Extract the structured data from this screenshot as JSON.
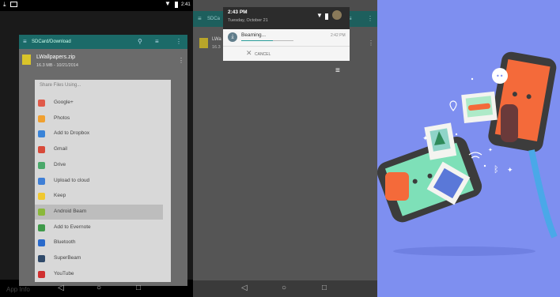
{
  "panel1": {
    "status_time": "2:41",
    "app_bar_title": "SDCard/Download",
    "file": {
      "name": "LWallpapers.zip",
      "meta": "16.3 MB - 10/21/2014"
    },
    "share_title": "Share Files Using...",
    "share_items": [
      {
        "label": "Google+",
        "color": "#e05a4a"
      },
      {
        "label": "Photos",
        "color": "#f0a030"
      },
      {
        "label": "Add to Dropbox",
        "color": "#3a84d8"
      },
      {
        "label": "Gmail",
        "color": "#d84a3a"
      },
      {
        "label": "Drive",
        "color": "#4aa86a"
      },
      {
        "label": "Upload to cloud",
        "color": "#3f7fd6"
      },
      {
        "label": "Keep",
        "color": "#f0c830"
      },
      {
        "label": "Android Beam",
        "color": "#8ab83a"
      },
      {
        "label": "Add to Evernote",
        "color": "#3f9a4a"
      },
      {
        "label": "Bluetooth",
        "color": "#2a6acb"
      },
      {
        "label": "SuperBeam",
        "color": "#304a6a"
      },
      {
        "label": "YouTube",
        "color": "#d03030"
      }
    ],
    "app_info": "App Info"
  },
  "panel2": {
    "notif_time": "2:43 PM",
    "notif_date": "Tuesday, October 21",
    "app_bar_partial": "SDCa",
    "file_partial": "LWa",
    "file_partial_meta": "16.3",
    "beaming_label": "Beaming...",
    "beaming_time": "2:42 PM",
    "cancel_label": "CANCEL",
    "beaming_progress": 0.6
  },
  "panel3": {
    "accent_bg": "#7e8ff0"
  },
  "nav": {
    "back": "◁",
    "home": "○",
    "recent": "□"
  }
}
